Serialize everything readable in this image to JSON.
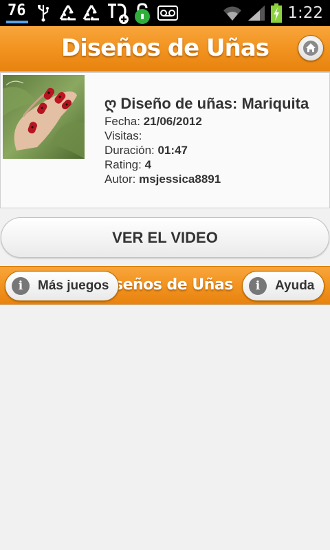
{
  "status_bar": {
    "time": "1:22",
    "notification_badge": "76",
    "icons": [
      "badge-76-icon",
      "usb-icon",
      "recycle-icon",
      "recycle-icon",
      "td-plus-icon",
      "lock-icon",
      "voicemail-icon",
      "wifi-icon",
      "signal-icon",
      "battery-charging-icon"
    ]
  },
  "header": {
    "title": "Diseños de Uñas"
  },
  "video": {
    "title": "ღ Diseño de uñas: Mariquita",
    "fecha_label": "Fecha:",
    "fecha_value": "21/06/2012",
    "visitas_label": "Visitas:",
    "visitas_value": "",
    "duracion_label": "Duración:",
    "duracion_value": "01:47",
    "rating_label": "Rating:",
    "rating_value": "4",
    "autor_label": "Autor:",
    "autor_value": "msjessica8891"
  },
  "actions": {
    "watch_label": "VER EL VIDEO"
  },
  "footer": {
    "title": "Diseños de Uñas",
    "more_games_label": "Más juegos",
    "help_label": "Ayuda",
    "info_icon_glyph": "i"
  },
  "colors": {
    "accent_orange": "#f39522",
    "background": "#f1f1f1"
  }
}
